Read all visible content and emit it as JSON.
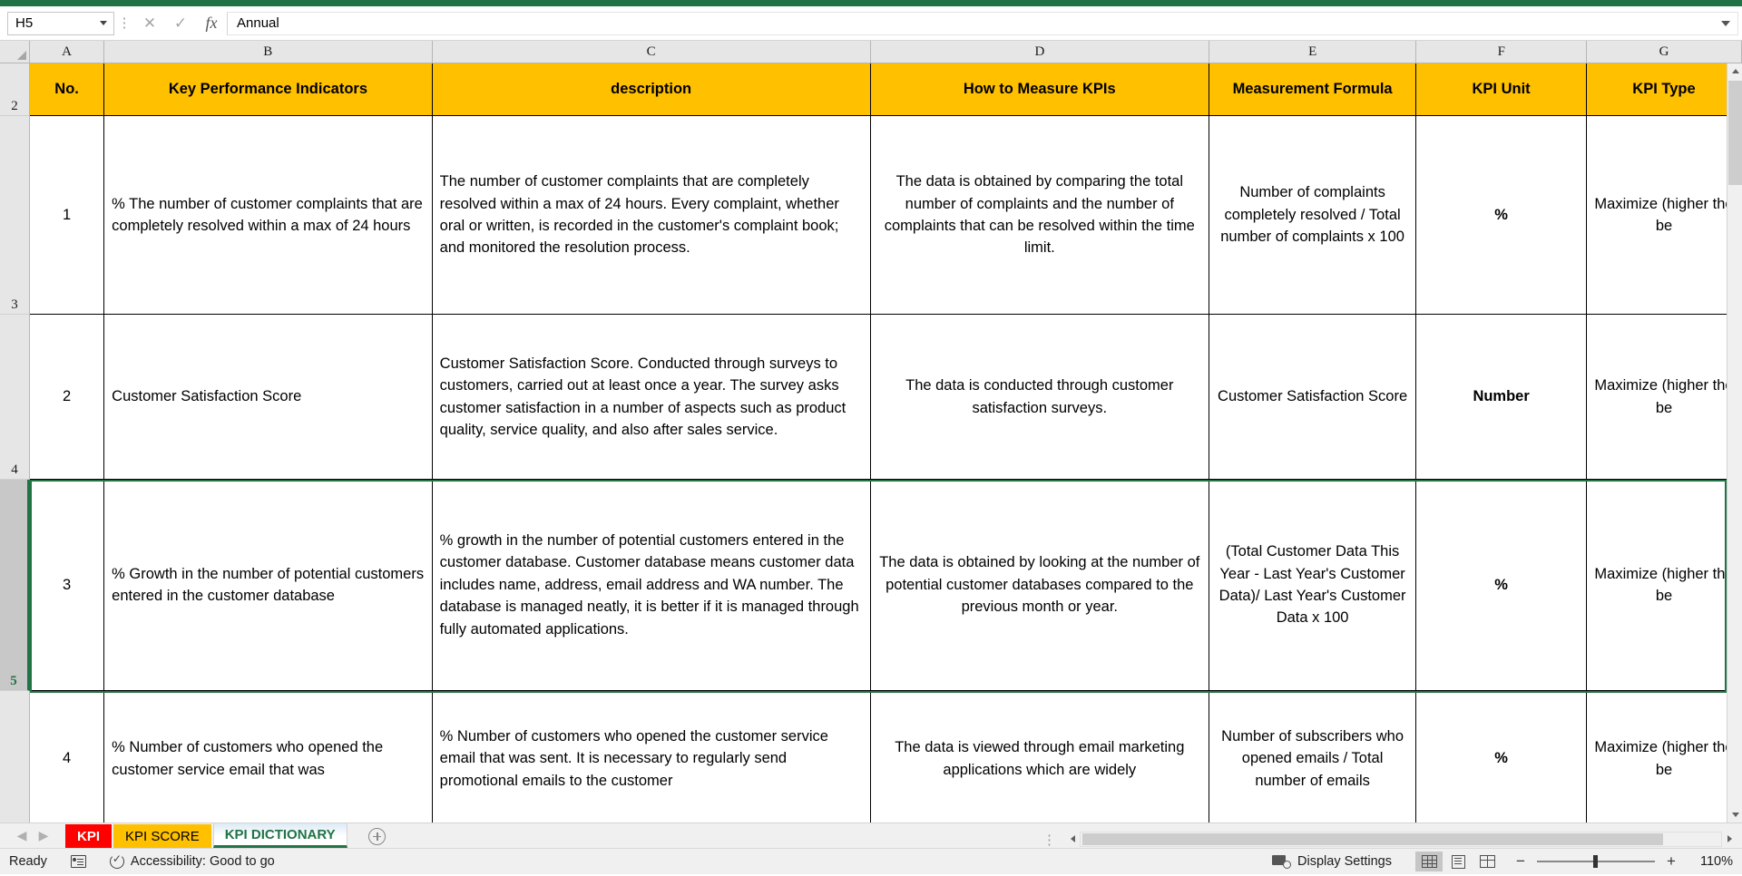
{
  "formula_bar": {
    "name_box_value": "H5",
    "formula_value": "Annual",
    "cancel_icon": "close-icon",
    "confirm_icon": "check-icon",
    "fx_label": "fx"
  },
  "grid": {
    "column_letters": [
      "A",
      "B",
      "C",
      "D",
      "E",
      "F",
      "G"
    ],
    "row_numbers": [
      "2",
      "3",
      "4",
      "5",
      ""
    ],
    "selected_row": "5",
    "headers": [
      "No.",
      "Key Performance Indicators",
      "description",
      "How to Measure KPIs",
      "Measurement Formula",
      "KPI Unit",
      "KPI Type"
    ],
    "header_fill": "#ffc000",
    "rows": [
      {
        "no": "1",
        "kpi": "% The number of customer complaints that are completely resolved within a max of 24 hours",
        "description": "The number of customer complaints that are completely resolved within a max of 24 hours. Every complaint, whether oral or written, is recorded in the customer's complaint book; and monitored the resolution process.",
        "how_to_measure": "The data is obtained by comparing the total number of complaints and the number of complaints that can be resolved within the time limit.",
        "formula": "Number of complaints completely resolved / Total number of complaints x 100",
        "unit": "%",
        "type": "Maximize (higher the be"
      },
      {
        "no": "2",
        "kpi": "Customer Satisfaction Score",
        "description": "Customer Satisfaction Score. Conducted through surveys to customers, carried out at least once a year. The survey asks customer satisfaction in a number of aspects such as product quality, service quality, and also after sales service.",
        "how_to_measure": "The data is conducted through customer satisfaction surveys.",
        "formula": "Customer Satisfaction Score",
        "unit": "Number",
        "type": "Maximize (higher the be"
      },
      {
        "no": "3",
        "kpi": "% Growth in the number of potential customers entered in the customer database",
        "description": "% growth in the number of potential customers entered in the customer database. Customer database means customer data includes name, address, email address and WA number. The database is managed neatly, it is better if it is managed through fully automated applications.",
        "how_to_measure": "The data is obtained by looking at the number of potential customer databases compared to the previous month or year.",
        "formula": "(Total Customer Data This Year - Last Year's Customer Data)/ Last Year's Customer Data x 100",
        "unit": "%",
        "type": "Maximize (higher the be"
      },
      {
        "no": "4",
        "kpi": "% Number of customers who opened the customer service email that was",
        "description": "% Number of customers who opened the customer service email that was sent. It is necessary to regularly send promotional emails to the customer",
        "how_to_measure": "The data is viewed through email marketing applications which are widely",
        "formula": "Number of subscribers who opened emails / Total number of emails",
        "unit": "%",
        "type": "Maximize (higher the be"
      }
    ]
  },
  "sheet_tabs": {
    "prev_icon": "chevron-left-icon",
    "next_icon": "chevron-right-icon",
    "add_icon": "plus-circle-icon",
    "items": [
      {
        "label": "KPI",
        "style": "red",
        "active": false
      },
      {
        "label": "KPI SCORE",
        "style": "orange",
        "active": false
      },
      {
        "label": "KPI DICTIONARY",
        "style": "active",
        "active": true
      }
    ]
  },
  "status_bar": {
    "ready_label": "Ready",
    "macro_icon": "macro-record-icon",
    "accessibility_label": "Accessibility: Good to go",
    "accessibility_icon": "accessibility-icon",
    "display_settings_label": "Display Settings",
    "display_settings_icon": "display-settings-icon",
    "view_normal_icon": "normal-view-icon",
    "view_page_layout_icon": "page-layout-icon",
    "view_page_break_icon": "page-break-preview-icon",
    "zoom_out_label": "−",
    "zoom_in_label": "+",
    "zoom_value": "110%"
  }
}
